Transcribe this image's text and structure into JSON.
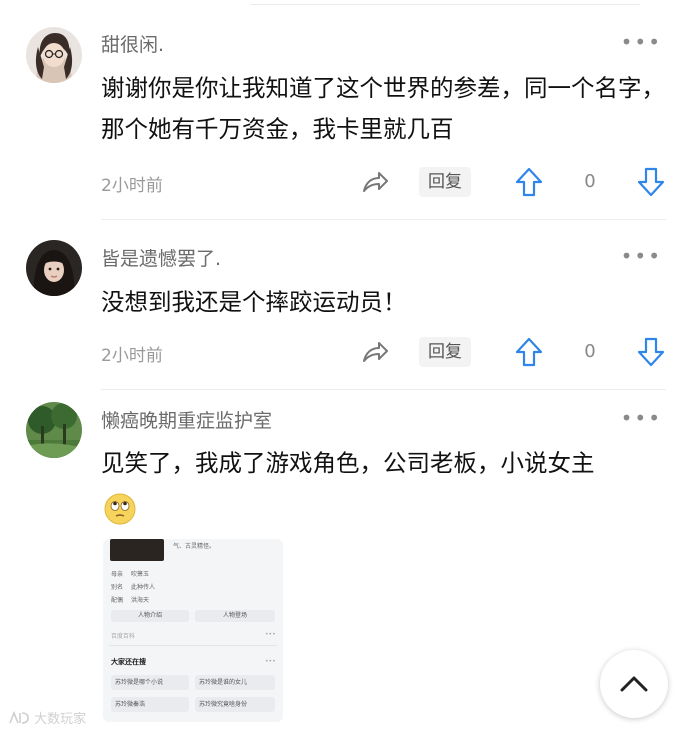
{
  "comments": [
    {
      "username": "甜很闲.",
      "text": "谢谢你是你让我知道了这个世界的参差，同一个名字，那个她有千万资金，我卡里就几百",
      "time": "2小时前",
      "reply_label": "回复",
      "vote_count": "0"
    },
    {
      "username": "皆是遗憾罢了.",
      "text": "没想到我还是个摔跤运动员！",
      "time": "2小时前",
      "reply_label": "回复",
      "vote_count": "0"
    },
    {
      "username": "懒癌晚期重症监护室",
      "text": "见笑了，我成了游戏角色，公司老板，小说女主"
    }
  ],
  "more_glyph": "•••",
  "thumbnail": {
    "top_caption": "气、古灵精怪。",
    "rows": [
      {
        "key": "母亲",
        "value": "吹箫玉"
      },
      {
        "key": "别名",
        "value": "此种传人"
      },
      {
        "key": "配偶",
        "value": "洪海天"
      }
    ],
    "pills": [
      "人物介绍",
      "人物登场"
    ],
    "baike": "百度百科",
    "related_title": "大家还在搜",
    "related": [
      "苏玲微是哪个小说",
      "苏玲微是谁的女儿",
      "苏玲微秦浩",
      "苏玲微究竟啥身份"
    ]
  },
  "watermark": "大数玩家",
  "icons": {
    "share": "share-icon",
    "upvote": "thumb-up-arrow-icon",
    "downvote": "thumb-down-arrow-icon",
    "scroll_top": "chevron-up-icon",
    "emoji": "eye-roll-emoji-icon"
  },
  "colors": {
    "accent_blue": "#2f86e8",
    "username_gray": "#6b6b6b",
    "meta_gray": "#9a9a9a"
  }
}
